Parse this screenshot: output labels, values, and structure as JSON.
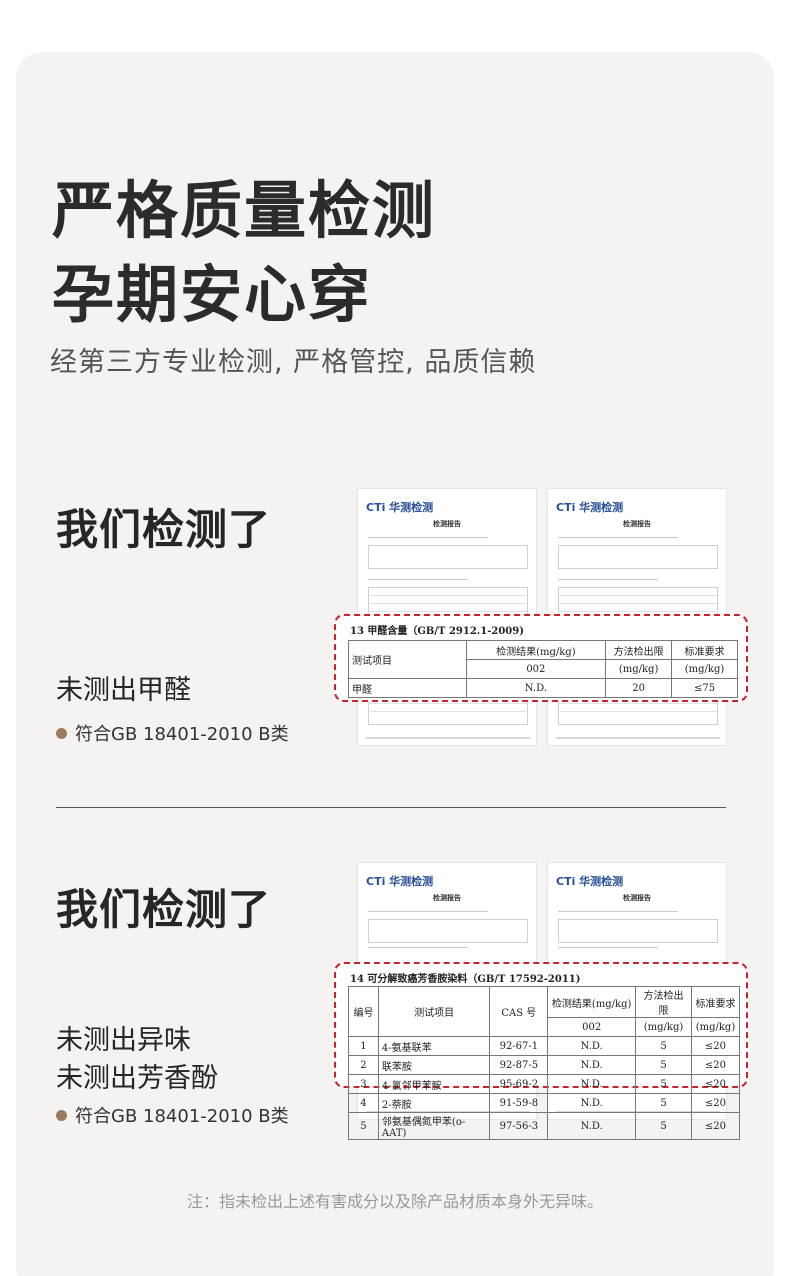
{
  "header": {
    "headline_line1": "严格质量检测",
    "headline_line2": "孕期安心穿",
    "subtitle": "经第三方专业检测, 严格管控, 品质信赖"
  },
  "section1": {
    "title": "我们检测了",
    "claim": "未测出甲醛",
    "standard": "符合GB 18401-2010 B类",
    "report_logo": "CTi 华测检测",
    "report_title": "检测报告",
    "zoom": {
      "caption": "13  甲醛含量（GB/T 2912.1-2009)",
      "h_item": "测试项目",
      "h_result": "检测结果(mg/kg)",
      "h_sample": "002",
      "h_limit": "方法检出限",
      "h_limit_unit": "(mg/kg)",
      "h_std": "标准要求",
      "h_std_unit": "(mg/kg)",
      "row_item": "甲醛",
      "row_result": "N.D.",
      "row_limit": "20",
      "row_std": "≤75"
    }
  },
  "section2": {
    "title": "我们检测了",
    "claim_line1": "未测出异味",
    "claim_line2": "未测出芳香酚",
    "standard": "符合GB 18401-2010 B类",
    "report_logo": "CTi 华测检测",
    "report_title": "检测报告",
    "zoom": {
      "caption": "14  可分解致癌芳香胺染料（GB/T 17592-2011)",
      "h_no": "编号",
      "h_item": "测试项目",
      "h_cas": "CAS 号",
      "h_result": "检测结果(mg/kg)",
      "h_sample": "002",
      "h_limit": "方法检出限",
      "h_limit_unit": "(mg/kg)",
      "h_std": "标准要求",
      "h_std_unit": "(mg/kg)",
      "rows": [
        {
          "no": "1",
          "item": "4-氨基联苯",
          "cas": "92-67-1",
          "result": "N.D.",
          "limit": "5",
          "std": "≤20"
        },
        {
          "no": "2",
          "item": "联苯胺",
          "cas": "92-87-5",
          "result": "N.D.",
          "limit": "5",
          "std": "≤20"
        },
        {
          "no": "3",
          "item": "4-氯邻甲苯胺",
          "cas": "95-69-2",
          "result": "N.D.",
          "limit": "5",
          "std": "≤20"
        },
        {
          "no": "4",
          "item": "2-萘胺",
          "cas": "91-59-8",
          "result": "N.D.",
          "limit": "5",
          "std": "≤20"
        },
        {
          "no": "5",
          "item": "邻氨基偶氮甲苯(o-AAT)",
          "cas": "97-56-3",
          "result": "N.D.",
          "limit": "5",
          "std": "≤20"
        }
      ]
    }
  },
  "footer_note": "注：指未检出上述有害成分以及除产品材质本身外无异味。"
}
